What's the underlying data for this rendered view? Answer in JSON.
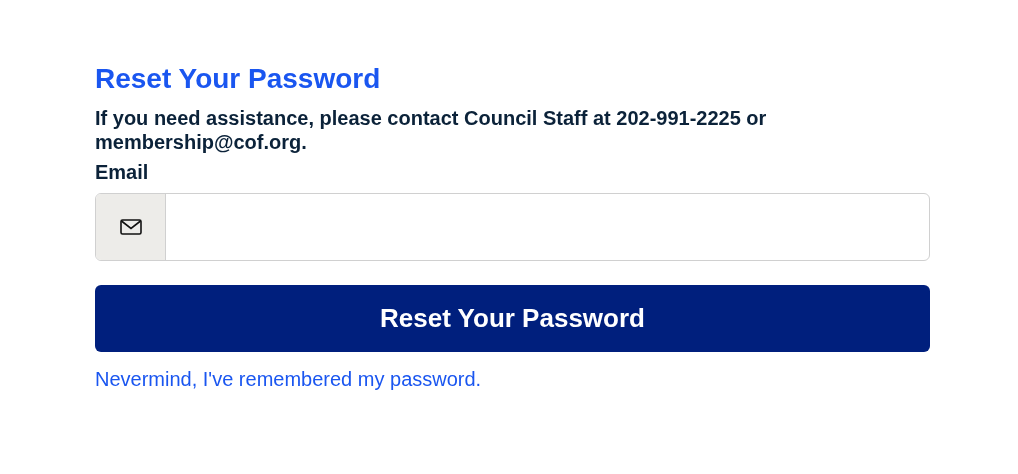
{
  "title": "Reset Your Password",
  "help_text": "If you need assistance, please contact Council Staff at 202-991-2225 or membership@cof.org.",
  "email_field": {
    "label": "Email"
  },
  "submit_button": "Reset Your Password",
  "back_link": "Nevermind, I've remembered my password."
}
